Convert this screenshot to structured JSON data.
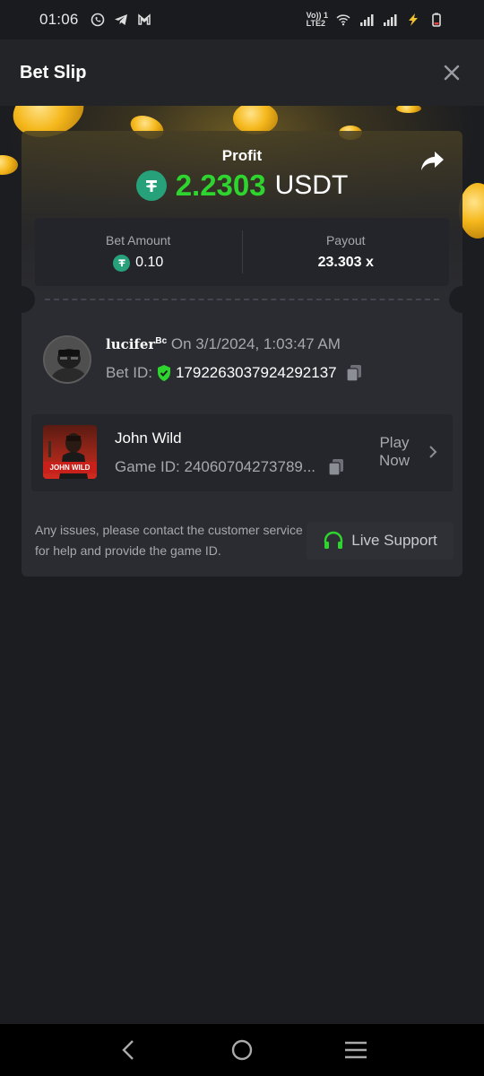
{
  "status_bar": {
    "time": "01:06",
    "left_icons": [
      "whatsapp-icon",
      "telegram-icon",
      "gmail-icon"
    ],
    "network_label_1": "Vo)) 1",
    "network_label_2": "LTE2",
    "right_icons": [
      "wifi-icon",
      "signal-icon",
      "signal-icon",
      "charging-bolt-icon",
      "battery-icon"
    ]
  },
  "header": {
    "title": "Bet Slip",
    "close_icon": "close-icon"
  },
  "profit": {
    "label": "Profit",
    "value": "2.2303",
    "currency": "USDT",
    "value_color": "#2fd52f"
  },
  "stats": {
    "bet_amount_label": "Bet Amount",
    "bet_amount_value": "0.10",
    "payout_label": "Payout",
    "payout_value": "23.303 x"
  },
  "bet_info": {
    "username": "lucifer",
    "username_sup": "Bc",
    "datetime": "On 3/1/2024, 1:03:47 AM",
    "bet_id_label": "Bet ID:",
    "bet_id": "1792263037924292137"
  },
  "game": {
    "name": "John Wild",
    "thumb_text": "JOHN WILD",
    "game_id_label": "Game ID:",
    "game_id": "24060704273789...",
    "play_now": "Play Now"
  },
  "footer": {
    "help_text": "Any issues, please contact the customer service for help and provide the game ID.",
    "live_support_label": "Live Support",
    "accent_color": "#2fd52f"
  },
  "nav": {
    "icons": [
      "back-icon",
      "home-icon",
      "recents-icon"
    ]
  }
}
